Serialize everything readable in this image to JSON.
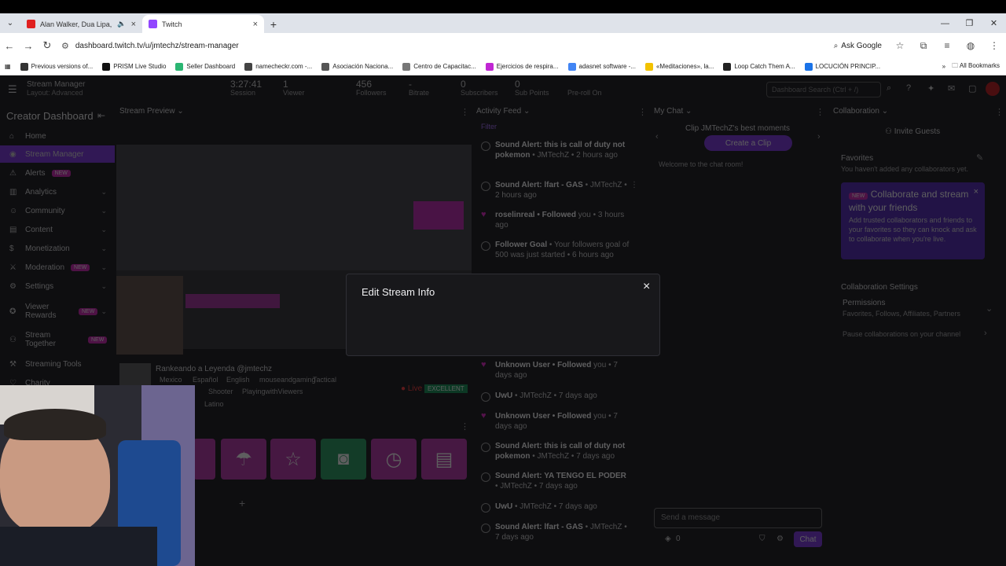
{
  "browser": {
    "tabs": [
      {
        "title": "Alan Walker, Dua Lipa, Colo",
        "favicon_color": "#e02020",
        "active": false
      },
      {
        "title": "Twitch",
        "favicon_color": "#9146ff",
        "active": true
      }
    ],
    "url": "dashboard.twitch.tv/u/jmtechz/stream-manager",
    "ask_google": "Ask Google",
    "bookmarks": [
      {
        "label": "Previous versions of...",
        "color": "#333"
      },
      {
        "label": "PRISM Live Studio",
        "color": "#111"
      },
      {
        "label": "Seller Dashboard",
        "color": "#2bb673"
      },
      {
        "label": "namecheckr.com -...",
        "color": "#444"
      },
      {
        "label": "Asociación Naciona...",
        "color": "#555"
      },
      {
        "label": "Centro de Capacitac...",
        "color": "#777"
      },
      {
        "label": "Ejercicios de respira...",
        "color": "#c026d3"
      },
      {
        "label": "adasnet software -...",
        "color": "#4285f4"
      },
      {
        "label": "«Meditaciones», la...",
        "color": "#f2c200"
      },
      {
        "label": "Loop Catch Them A...",
        "color": "#222"
      },
      {
        "label": "LOCUCIÓN PRINCIP...",
        "color": "#1a73e8"
      }
    ],
    "all_bookmarks": "All Bookmarks"
  },
  "dashboard": {
    "header": {
      "title": "Stream Manager",
      "subtitle": "Layout: Advanced",
      "stats": [
        {
          "value": "3:27:41",
          "label": "Session"
        },
        {
          "value": "1",
          "label": "Viewer"
        },
        {
          "value": "456",
          "label": "Followers"
        },
        {
          "value": "-",
          "label": "Bitrate"
        },
        {
          "value": "0",
          "label": "Subscribers"
        },
        {
          "value": "0",
          "label": "Sub Points"
        },
        {
          "value": "",
          "label": "Pre-roll On"
        }
      ],
      "search_placeholder": "Dashboard Search (Ctrl + /)"
    },
    "sidebar": {
      "title": "Creator Dashboard",
      "items": [
        {
          "label": "Home",
          "icon": "home-icon",
          "glyph": "⌂"
        },
        {
          "label": "Stream Manager",
          "icon": "stream-icon",
          "glyph": "◉",
          "active": true
        },
        {
          "label": "Alerts",
          "icon": "alert-icon",
          "glyph": "⚠",
          "badge": "NEW"
        },
        {
          "label": "Analytics",
          "icon": "analytics-icon",
          "glyph": "▥",
          "chevron": true
        },
        {
          "label": "Community",
          "icon": "community-icon",
          "glyph": "☺",
          "chevron": true
        },
        {
          "label": "Content",
          "icon": "content-icon",
          "glyph": "▤",
          "chevron": true
        },
        {
          "label": "Monetization",
          "icon": "money-icon",
          "glyph": "$",
          "chevron": true
        },
        {
          "label": "Moderation",
          "icon": "moderation-icon",
          "glyph": "⚔",
          "badge": "NEW",
          "chevron": true
        },
        {
          "label": "Settings",
          "icon": "settings-icon",
          "glyph": "⚙",
          "chevron": true
        },
        {
          "label": "Viewer Rewards",
          "icon": "rewards-icon",
          "glyph": "✪",
          "badge": "NEW",
          "chevron": true
        },
        {
          "label": "Stream Together",
          "icon": "together-icon",
          "glyph": "⚇",
          "badge": "NEW"
        },
        {
          "label": "Streaming Tools",
          "icon": "tools-icon",
          "glyph": "⚒"
        },
        {
          "label": "Charity",
          "icon": "charity-icon",
          "glyph": "♡"
        }
      ]
    },
    "preview": {
      "header": "Stream Preview",
      "stream_title": "Rankeando a Leyenda @jmtechz",
      "tags": [
        "Mexico",
        "Español",
        "English",
        "mouseandgaming",
        "Tactical",
        "Shooter",
        "PlayingwithViewers",
        "Latino"
      ],
      "live": "Live",
      "quality": "EXCELLENT"
    },
    "activity": {
      "header": "Activity Feed",
      "filter": "Filter",
      "items": [
        {
          "bold": "Sound Alert: this is call of duty not pokemon",
          "rest": " • JMTechZ • 2 hours ago",
          "type": "circle"
        },
        {
          "bold": "Sound Alert: lfart - GAS",
          "rest": " • JMTechZ • 2 hours ago",
          "type": "circle"
        },
        {
          "bold": "roselinreal • Followed",
          "rest": " you • 3 hours ago",
          "type": "heart"
        },
        {
          "bold": "Follower Goal",
          "rest": " • Your followers goal of 500 was just started • 6 hours ago",
          "type": "circle"
        },
        {
          "bold": "Unknown User • Followed",
          "rest": " you • 7 days ago",
          "type": "heart"
        },
        {
          "bold": "UwU",
          "rest": " • JMTechZ • 7 days ago",
          "type": "circle"
        },
        {
          "bold": "Unknown User • Followed",
          "rest": " you • 7 days ago",
          "type": "heart"
        },
        {
          "bold": "Sound Alert: this is call of duty not pokemon",
          "rest": " • JMTechZ • 7 days ago",
          "type": "circle"
        },
        {
          "bold": "Sound Alert: YA TENGO EL PODER",
          "rest": " • JMTechZ • 7 days ago",
          "type": "circle"
        },
        {
          "bold": "UwU",
          "rest": " • JMTechZ • 7 days ago",
          "type": "circle"
        },
        {
          "bold": "Sound Alert: lfart - GAS",
          "rest": " • JMTechZ • 7 days ago",
          "type": "circle"
        }
      ]
    },
    "chat": {
      "header": "My Chat",
      "clip_title": "Clip JMTechZ's best moments",
      "create_clip": "Create a Clip",
      "welcome": "Welcome to the chat room!",
      "send_placeholder": "Send a message",
      "points": "0",
      "chat_button": "Chat"
    },
    "collaboration": {
      "header": "Collaboration",
      "invite": "Invite Guests",
      "favorites_title": "Favorites",
      "favorites_desc": "You haven't added any collaborators yet.",
      "card_badge": "NEW",
      "card_title": "Collaborate and stream with your friends",
      "card_desc": "Add trusted collaborators and friends to your favorites so they can knock and ask to collaborate when you're live.",
      "settings_title": "Collaboration Settings",
      "permissions": "Permissions",
      "permissions_desc": "Favorites, Follows, Affiliates, Partners",
      "pause": "Pause collaborations on your channel"
    }
  },
  "modal": {
    "title": "Edit Stream Info",
    "close": "×"
  }
}
